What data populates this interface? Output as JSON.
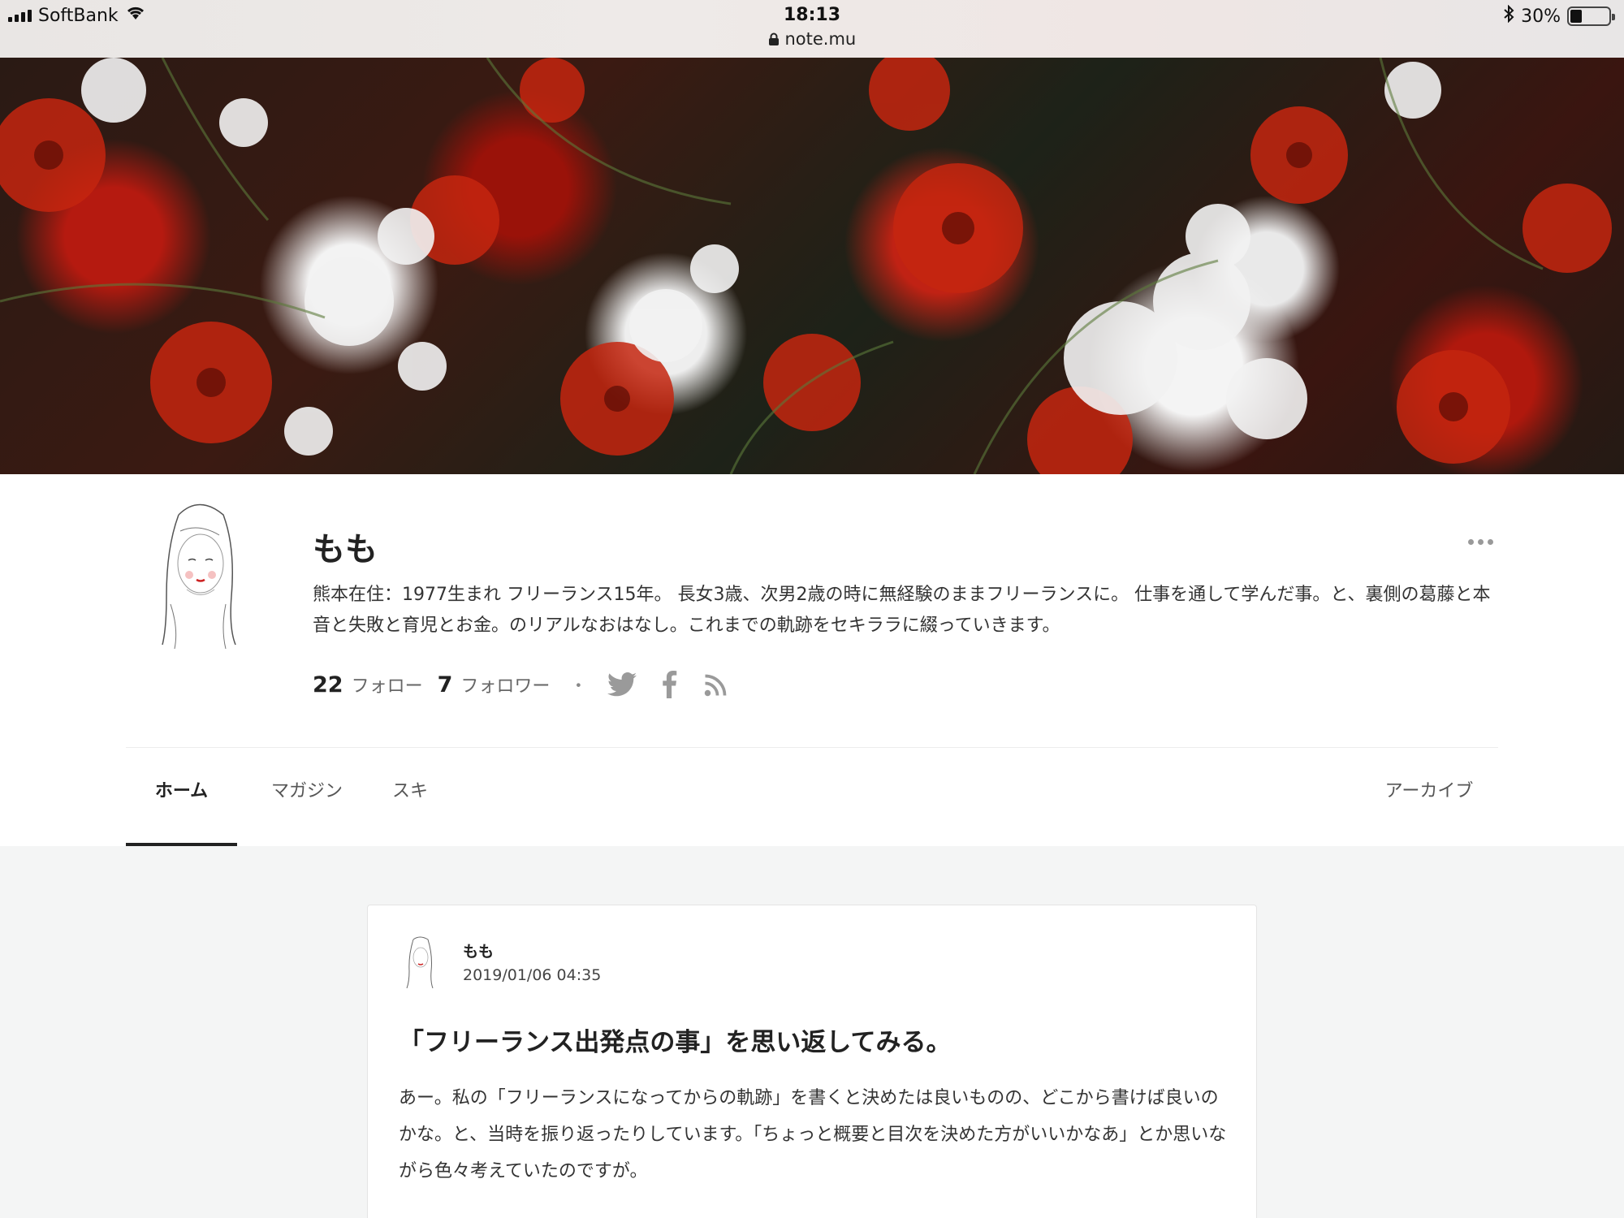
{
  "status_bar": {
    "carrier": "SoftBank",
    "time": "18:13",
    "url": "note.mu",
    "battery": "30%",
    "battery_level": 0.3
  },
  "profile": {
    "name": "もも",
    "bio": "熊本在住：1977生まれ フリーランス15年。 長女3歳、次男2歳の時に無経験のままフリーランスに。 仕事を通して学んだ事。と、裏側の葛藤と本音と失敗と育児とお金。のリアルなおはなし。これまでの軌跡をセキララに綴っていきます。",
    "following_count": "22",
    "following_label": "フォロー",
    "followers_count": "7",
    "followers_label": "フォロワー",
    "separator": "・",
    "social_icons": [
      "twitter-icon",
      "facebook-icon",
      "rss-icon"
    ]
  },
  "tabs": [
    {
      "label": "ホーム",
      "active": true
    },
    {
      "label": "マガジン",
      "active": false
    },
    {
      "label": "スキ",
      "active": false
    },
    {
      "label": "アーカイブ",
      "active": false
    }
  ],
  "post": {
    "author": "もも",
    "date": "2019/01/06 04:35",
    "title": "「フリーランス出発点の事」を思い返してみる。",
    "excerpt": "あー。私の「フリーランスになってからの軌跡」を書くと決めたは良いものの、どこから書けば良いのかな。と、当時を振り返ったりしています。「ちょっと概要と目次を決めた方がいいかなあ」とか思いながら色々考えていたのですが。"
  },
  "colors": {
    "text": "#222222",
    "muted": "#666666",
    "background": "#f4f5f5",
    "card": "#ffffff",
    "hero_red": "#b51a10"
  }
}
